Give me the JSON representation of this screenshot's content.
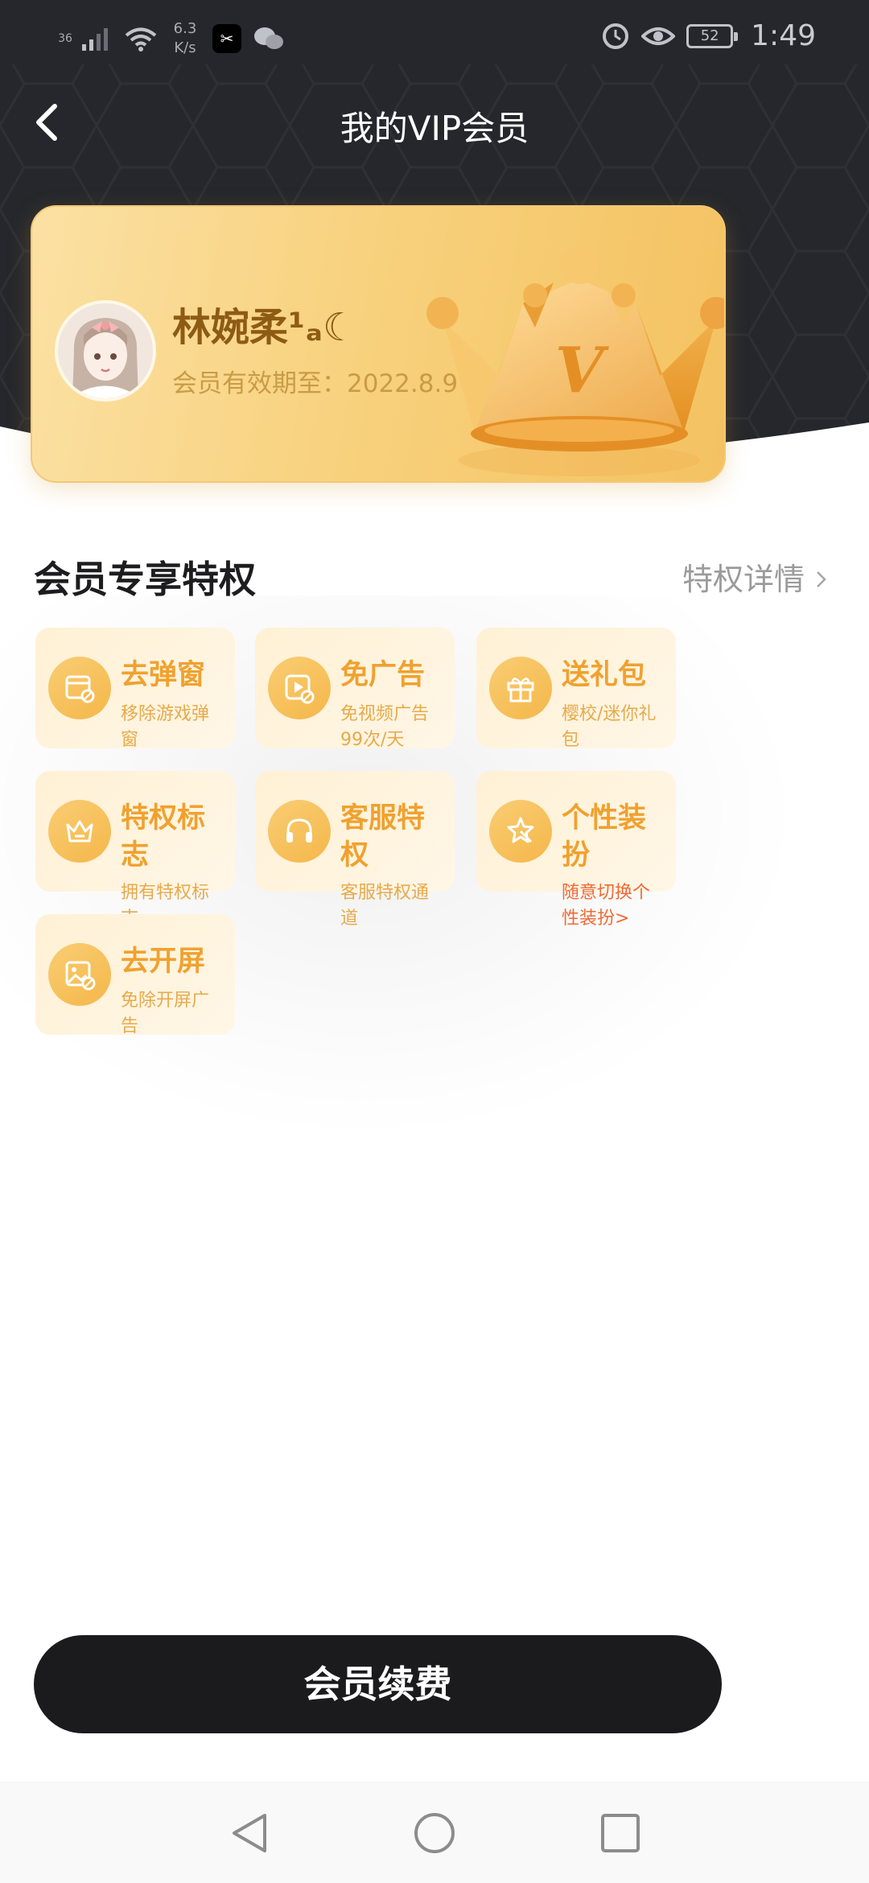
{
  "status_bar": {
    "signal": "36",
    "net_speed_value": "6.3",
    "net_speed_unit": "K/s",
    "app_icon_1": "capcut-icon",
    "app_icon_2": "wechat-icon",
    "battery": "52",
    "time": "1:49"
  },
  "nav": {
    "title": "我的VIP会员"
  },
  "vip_card": {
    "user_name": "林婉柔¹ₐ☾",
    "expiry_label": "会员有效期至：",
    "expiry_date": "2022.8.9",
    "crown_letter": "V"
  },
  "privileges": {
    "title": "会员专享特权",
    "more_label": "特权详情",
    "items": [
      {
        "icon": "popup-icon",
        "title": "去弹窗",
        "desc": "移除游戏弹窗"
      },
      {
        "icon": "play-icon",
        "title": "免广告",
        "desc": "免视频广告99次/天"
      },
      {
        "icon": "gift-icon",
        "title": "送礼包",
        "desc": "樱校/迷你礼包"
      },
      {
        "icon": "crown-badge-icon",
        "title": "特权标志",
        "desc": "拥有特权标志"
      },
      {
        "icon": "headset-icon",
        "title": "客服特权",
        "desc": "客服特权通道"
      },
      {
        "icon": "costume-icon",
        "title": "个性装扮",
        "desc": "随意切换个性装扮>"
      },
      {
        "icon": "splash-image-icon",
        "title": "去开屏",
        "desc": "免除开屏广告"
      }
    ]
  },
  "renew_button": "会员续费",
  "colors": {
    "header_bg": "#25272c",
    "card_gold": "#f8d27f",
    "accent_orange": "#f0a12e",
    "accent_red": "#ef6a36",
    "button_bg": "#1b1b1d"
  }
}
